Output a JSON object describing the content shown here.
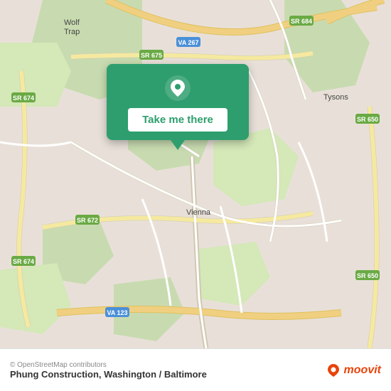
{
  "map": {
    "background_color": "#e8e0d8",
    "center": "Vienna, VA",
    "attribution": "© OpenStreetMap contributors"
  },
  "popup": {
    "button_label": "Take me there",
    "background_color": "#2e9e6e"
  },
  "bottom_bar": {
    "attribution": "© OpenStreetMap contributors",
    "location_name": "Phung Construction, Washington / Baltimore",
    "brand": "moovit"
  },
  "labels": {
    "wolf_trap": "Wolf Trap",
    "tysons": "Tysons",
    "vienna": "Vienna",
    "sr_675": "SR 675",
    "sr_684": "SR 684",
    "sr_674_top": "SR 674",
    "sr_674_bot": "SR 674",
    "sr_672": "SR 672",
    "sr_650_top": "SR 650",
    "sr_650_bot": "SR 650",
    "va_267": "VA 267",
    "va_123": "VA 123"
  }
}
